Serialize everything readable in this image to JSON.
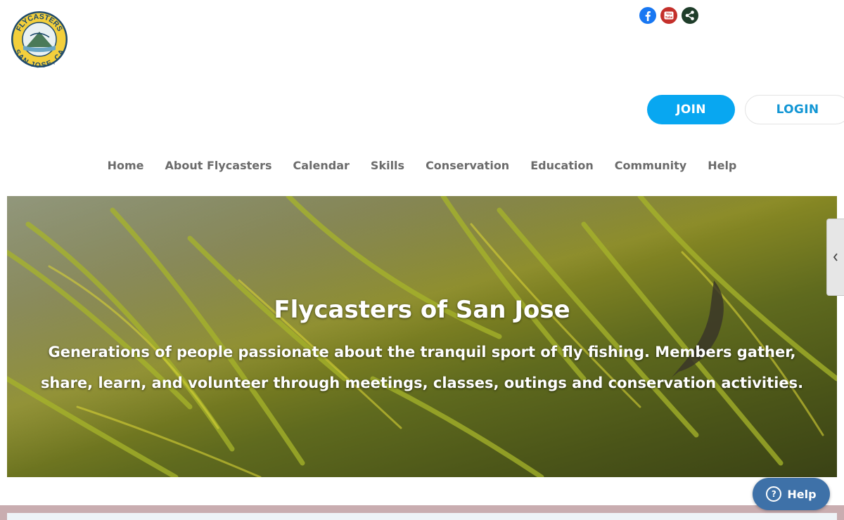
{
  "logo": {
    "text_top": "FLYCASTERS",
    "text_bottom": "SAN JOSE, CA"
  },
  "social": [
    {
      "name": "facebook-icon"
    },
    {
      "name": "youtube-icon",
      "label": "You Tube"
    },
    {
      "name": "share-icon"
    }
  ],
  "auth": {
    "join_label": "JOIN",
    "login_label": "LOGIN"
  },
  "nav": {
    "items": [
      {
        "label": "Home"
      },
      {
        "label": "About Flycasters"
      },
      {
        "label": "Calendar"
      },
      {
        "label": "Skills"
      },
      {
        "label": "Conservation"
      },
      {
        "label": "Education"
      },
      {
        "label": "Community"
      },
      {
        "label": "Help"
      }
    ]
  },
  "hero": {
    "title": "Flycasters of San Jose",
    "subtitle_line1": "Generations of people passionate about the tranquil sport of fly fishing. Members gather,",
    "subtitle_line2": "share, learn, and volunteer through meetings, classes, outings and conservation activities."
  },
  "help_widget": {
    "label": "Help",
    "icon": "?"
  },
  "colors": {
    "join_bg": "#08a7f1",
    "login_text": "#1296d4",
    "nav_text": "#6b6b6b",
    "help_bg": "#3e71a8",
    "bottom_band": "#c9adb0"
  }
}
